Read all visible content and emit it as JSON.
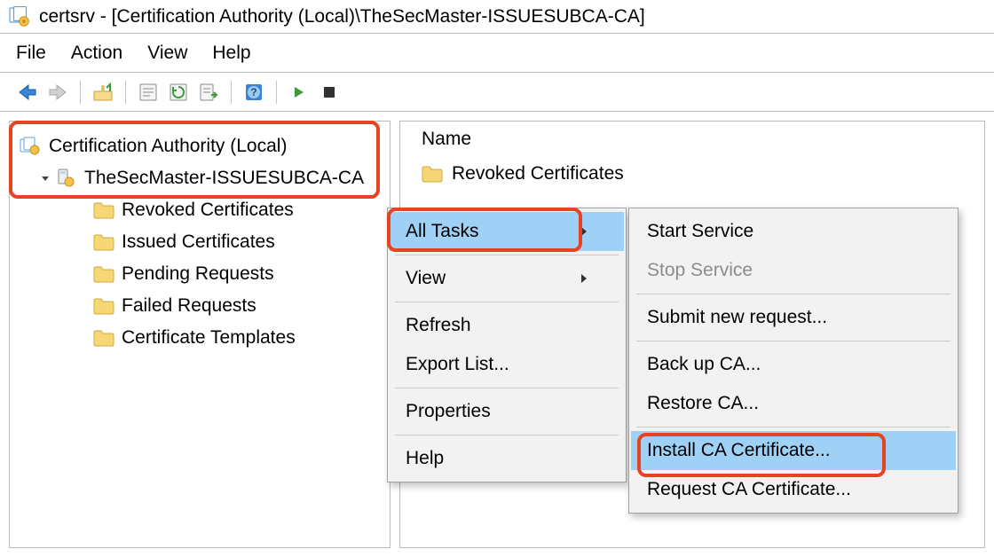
{
  "title": "certsrv - [Certification Authority (Local)\\TheSecMaster-ISSUESUBCA-CA]",
  "menu": {
    "file": "File",
    "action": "Action",
    "view": "View",
    "help": "Help"
  },
  "tree": {
    "root": "Certification Authority (Local)",
    "ca": "TheSecMaster-ISSUESUBCA-CA",
    "children": [
      "Revoked Certificates",
      "Issued Certificates",
      "Pending Requests",
      "Failed Requests",
      "Certificate Templates"
    ]
  },
  "list": {
    "header_name": "Name",
    "first_row": "Revoked Certificates"
  },
  "context_menu": {
    "all_tasks": "All Tasks",
    "view": "View",
    "refresh": "Refresh",
    "export_list": "Export List...",
    "properties": "Properties",
    "help": "Help"
  },
  "submenu": {
    "start_service": "Start Service",
    "stop_service": "Stop Service",
    "submit_request": "Submit new request...",
    "backup_ca": "Back up CA...",
    "restore_ca": "Restore CA...",
    "install_ca_cert": "Install CA Certificate...",
    "request_ca_cert": "Request CA Certificate..."
  },
  "icons": {
    "app": "certsrv-icon",
    "server": "ca-server-icon",
    "folder": "folder-icon"
  }
}
